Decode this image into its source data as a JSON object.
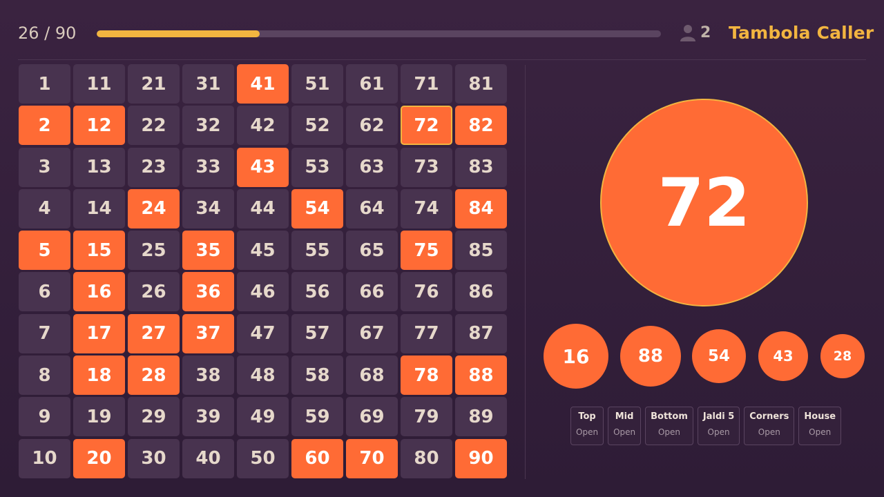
{
  "header": {
    "counter": "26 / 90",
    "progress_fraction": 0.289,
    "players_icon": "user-icon",
    "players_count": "2",
    "title": "Tambola Caller"
  },
  "colors": {
    "background": "#3a2340",
    "cell": "#48334f",
    "called": "#ff6b35",
    "accent": "#f2b540"
  },
  "board": {
    "called": [
      2,
      5,
      12,
      15,
      16,
      17,
      18,
      20,
      24,
      27,
      28,
      35,
      36,
      37,
      41,
      43,
      54,
      60,
      70,
      72,
      75,
      78,
      82,
      84,
      88,
      90
    ],
    "current": 72
  },
  "current_ball": "72",
  "recent_balls": [
    "16",
    "88",
    "54",
    "43",
    "28"
  ],
  "prizes": [
    {
      "name": "Top",
      "status": "Open"
    },
    {
      "name": "Mid",
      "status": "Open"
    },
    {
      "name": "Bottom",
      "status": "Open"
    },
    {
      "name": "Jaldi 5",
      "status": "Open"
    },
    {
      "name": "Corners",
      "status": "Open"
    },
    {
      "name": "House",
      "status": "Open"
    }
  ]
}
